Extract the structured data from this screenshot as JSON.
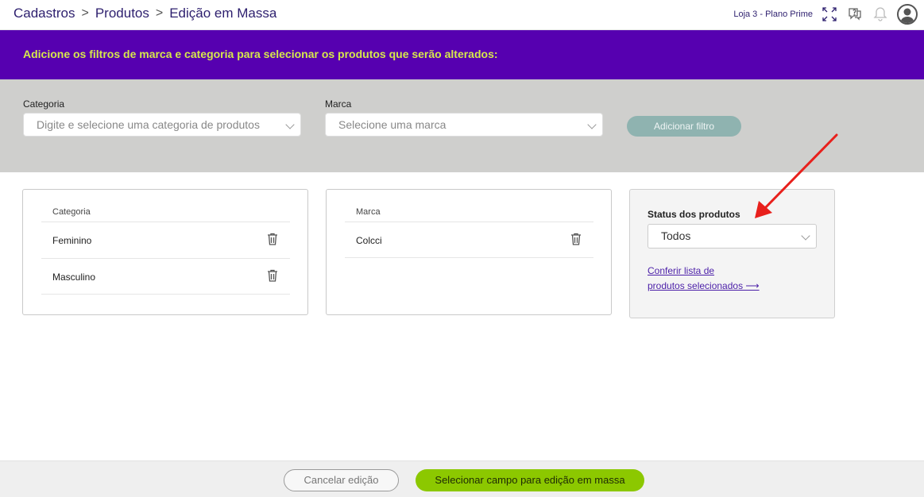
{
  "breadcrumb": {
    "items": [
      "Cadastros",
      "Produtos",
      "Edição em Massa"
    ],
    "separator": ">"
  },
  "header": {
    "store_label": "Loja 3 - Plano Prime",
    "icons": [
      "expand-icon",
      "help-chat-icon",
      "bell-icon",
      "user-avatar-icon"
    ]
  },
  "banner": {
    "text": "Adicione os filtros de marca e categoria para selecionar os produtos que serão alterados:",
    "background": "#5600b0",
    "text_color": "#d6e84b"
  },
  "filters": {
    "category_label": "Categoria",
    "category_placeholder": "Digite e selecione uma categoria de produtos",
    "brand_label": "Marca",
    "brand_placeholder": "Selecione uma marca",
    "add_button": "Adicionar filtro"
  },
  "category_card": {
    "header": "Categoria",
    "items": [
      "Feminino",
      "Masculino"
    ]
  },
  "brand_card": {
    "header": "Marca",
    "items": [
      "Colcci"
    ]
  },
  "status_card": {
    "label": "Status dos produtos",
    "selected": "Todos",
    "link_line1": "Conferir lista de",
    "link_line2": "produtos selecionados ⟶"
  },
  "footer": {
    "cancel_label": "Cancelar edição",
    "select_label": "Selecionar campo para edição em massa",
    "accent": "#8cc800"
  },
  "annotation": {
    "arrow_color": "#e8201c"
  }
}
